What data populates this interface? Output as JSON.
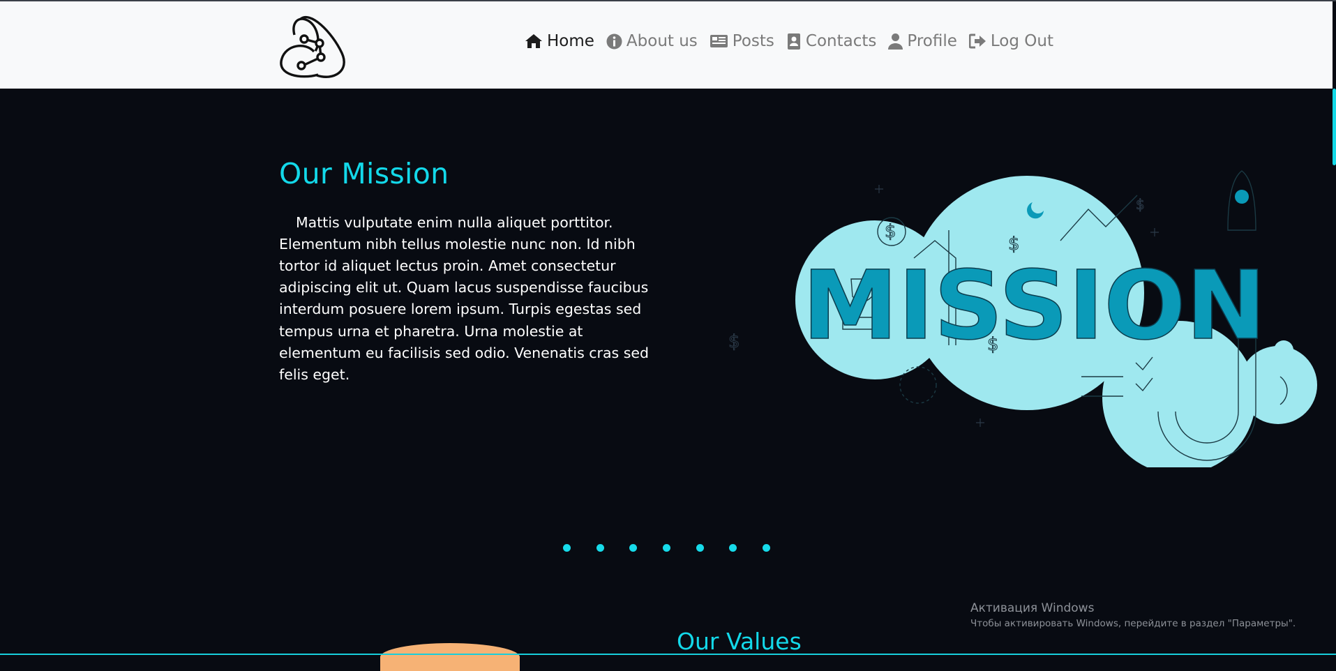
{
  "nav": {
    "items": [
      {
        "label": "Home",
        "icon": "home-icon"
      },
      {
        "label": "About us",
        "icon": "info-icon"
      },
      {
        "label": "Posts",
        "icon": "newspaper-icon"
      },
      {
        "label": "Contacts",
        "icon": "address-book-icon"
      },
      {
        "label": "Profile",
        "icon": "user-icon"
      },
      {
        "label": "Log Out",
        "icon": "sign-out-icon"
      }
    ],
    "active": "Home"
  },
  "mission": {
    "title": "Our Mission",
    "text": "Mattis vulputate enim nulla aliquet porttitor. Elementum nibh tellus molestie nunc non. Id nibh tortor id aliquet lectus proin. Amet consectetur adipiscing elit ut. Quam lacus suspendisse faucibus interdum posuere lorem ipsum. Turpis egestas sed tempus urna et pharetra. Urna molestie at elementum eu facilisis sed odio. Venenatis cras sed felis eget.",
    "illustration_word": "MISSION"
  },
  "carousel": {
    "dot_count": 7
  },
  "values": {
    "title": "Our Values"
  },
  "windows_activation": {
    "title": "Активация Windows",
    "subtitle": "Чтобы активировать Windows, перейдите в раздел \"Параметры\"."
  },
  "colors": {
    "accent": "#13d9ea",
    "background": "#080b12",
    "navbar": "#f8f9fa",
    "illustration_light": "#9fe8ef",
    "illustration_dark": "#0a9ab8",
    "orange": "#f6b275"
  }
}
